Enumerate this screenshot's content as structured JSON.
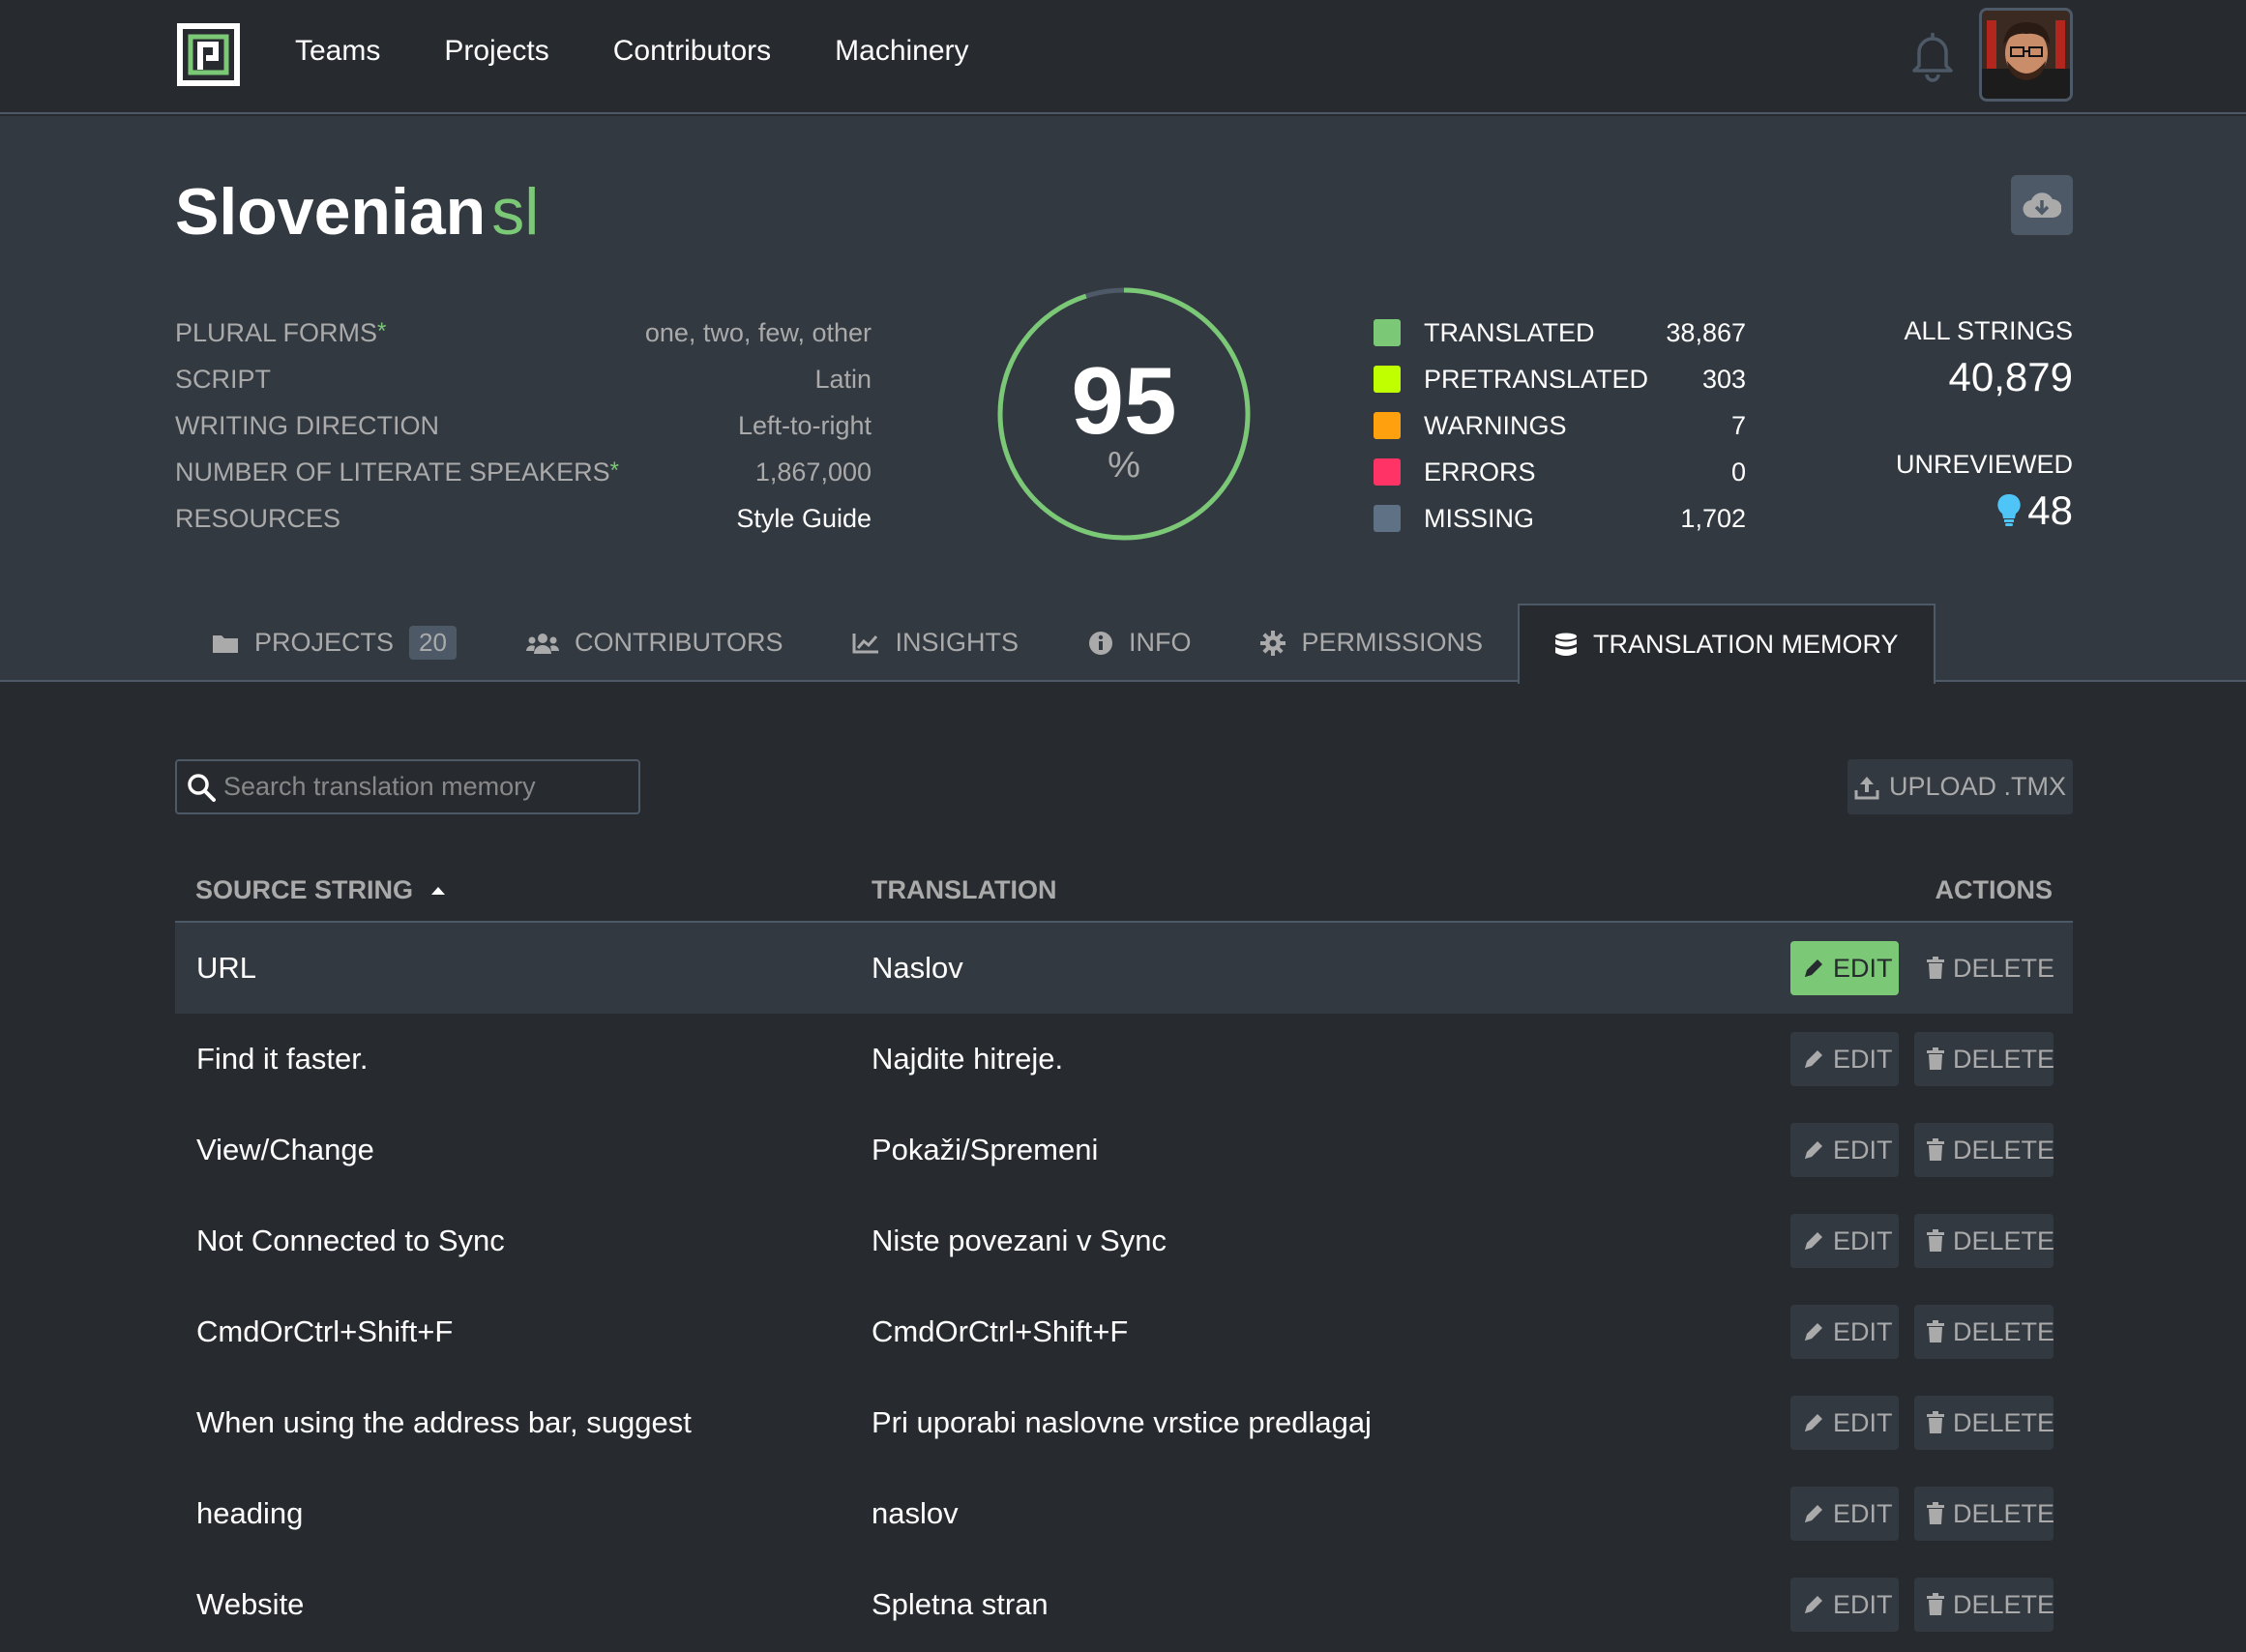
{
  "nav": {
    "items": [
      "Teams",
      "Projects",
      "Contributors",
      "Machinery"
    ]
  },
  "locale": {
    "name": "Slovenian",
    "code": "sl"
  },
  "info": [
    {
      "label": "PLURAL FORMS",
      "asterisk": "*",
      "value": "one, two, few, other"
    },
    {
      "label": "SCRIPT",
      "asterisk": "",
      "value": "Latin"
    },
    {
      "label": "WRITING DIRECTION",
      "asterisk": "",
      "value": "Left-to-right"
    },
    {
      "label": "NUMBER OF LITERATE SPEAKERS",
      "asterisk": "*",
      "value": "1,867,000"
    },
    {
      "label": "RESOURCES",
      "asterisk": "",
      "value": "Style Guide"
    }
  ],
  "progress": {
    "value": "95",
    "unit": "%",
    "fraction": 0.95
  },
  "legend": [
    {
      "label": "TRANSLATED",
      "value": "38,867",
      "color": "#7bc876"
    },
    {
      "label": "PRETRANSLATED",
      "value": "303",
      "color": "#c0ff00"
    },
    {
      "label": "WARNINGS",
      "value": "7",
      "color": "#ffa10f"
    },
    {
      "label": "ERRORS",
      "value": "0",
      "color": "#f36"
    },
    {
      "label": "MISSING",
      "value": "1,702",
      "color": "#5f7285"
    }
  ],
  "totals": {
    "all_label": "ALL STRINGS",
    "all_value": "40,879",
    "unreviewed_label": "UNREVIEWED",
    "unreviewed_value": "48"
  },
  "tabs": [
    {
      "label": "PROJECTS",
      "badge": "20",
      "icon": "folder-icon"
    },
    {
      "label": "CONTRIBUTORS",
      "icon": "users-icon"
    },
    {
      "label": "INSIGHTS",
      "icon": "chart-icon"
    },
    {
      "label": "INFO",
      "icon": "info-icon"
    },
    {
      "label": "PERMISSIONS",
      "icon": "gear-icon"
    },
    {
      "label": "TRANSLATION MEMORY",
      "icon": "database-icon",
      "active": true
    }
  ],
  "search": {
    "placeholder": "Search translation memory"
  },
  "upload_label": "UPLOAD .TMX",
  "table": {
    "headers": {
      "source": "SOURCE STRING",
      "translation": "TRANSLATION",
      "actions": "ACTIONS"
    },
    "edit_label": "EDIT",
    "delete_label": "DELETE",
    "rows": [
      {
        "source": "URL",
        "translation": "Naslov"
      },
      {
        "source": "Find it faster.",
        "translation": "Najdite hitreje."
      },
      {
        "source": "View/Change",
        "translation": "Pokaži/Spremeni"
      },
      {
        "source": "Not Connected to Sync",
        "translation": "Niste povezani v Sync"
      },
      {
        "source": "CmdOrCtrl+Shift+F",
        "translation": "CmdOrCtrl+Shift+F"
      },
      {
        "source": "When using the address bar, suggest",
        "translation": "Pri uporabi naslovne vrstice predlagaj"
      },
      {
        "source": "heading",
        "translation": "naslov"
      },
      {
        "source": "Website",
        "translation": "Spletna stran"
      }
    ]
  }
}
